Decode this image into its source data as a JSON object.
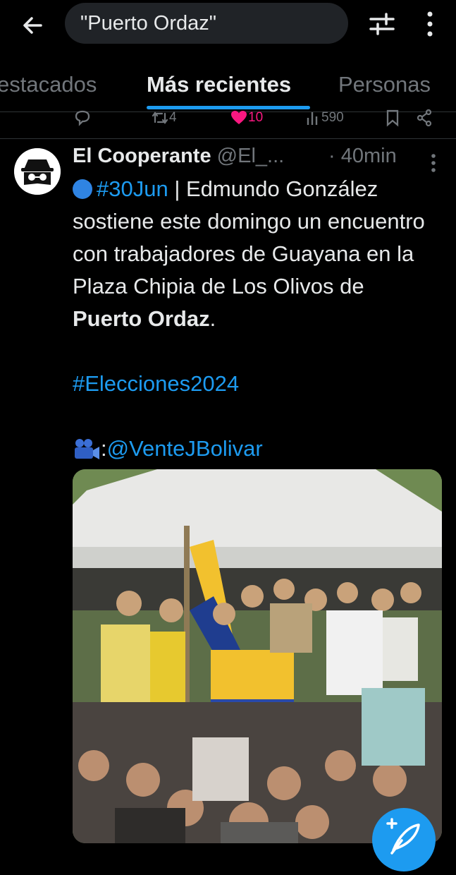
{
  "search": {
    "query": "\"Puerto Ordaz\""
  },
  "tabs": [
    {
      "label": "estacados",
      "active": false
    },
    {
      "label": "Más recientes",
      "active": true
    },
    {
      "label": "Personas",
      "active": false
    }
  ],
  "previous_tweet": {
    "retweets": "4",
    "likes": "10",
    "views": "590"
  },
  "tweet": {
    "author_name": "El Cooperante",
    "handle": "@El_...",
    "time": "· 40min",
    "hashtag_date": "#30Jun",
    "text_1": " | Edmundo González sostiene este domingo un encuentro con trabajadores de Guayana en la Plaza Chipia de Los Olivos de ",
    "text_bold": "Puerto Ordaz",
    "text_end": ".",
    "hashtag_2": "#Elecciones2024",
    "credit_prefix": ":",
    "credit_mention": "@VenteJBolivar"
  },
  "colors": {
    "accent": "#1d9bf0",
    "like": "#f91880",
    "muted": "#71767b",
    "text": "#e7e9ea",
    "background": "#000000"
  },
  "icons": [
    "back-arrow-icon",
    "filter-icon",
    "more-vertical-icon",
    "reply-icon",
    "retweet-icon",
    "heart-icon",
    "views-icon",
    "bookmark-icon",
    "share-icon",
    "camera-icon",
    "compose-icon"
  ]
}
